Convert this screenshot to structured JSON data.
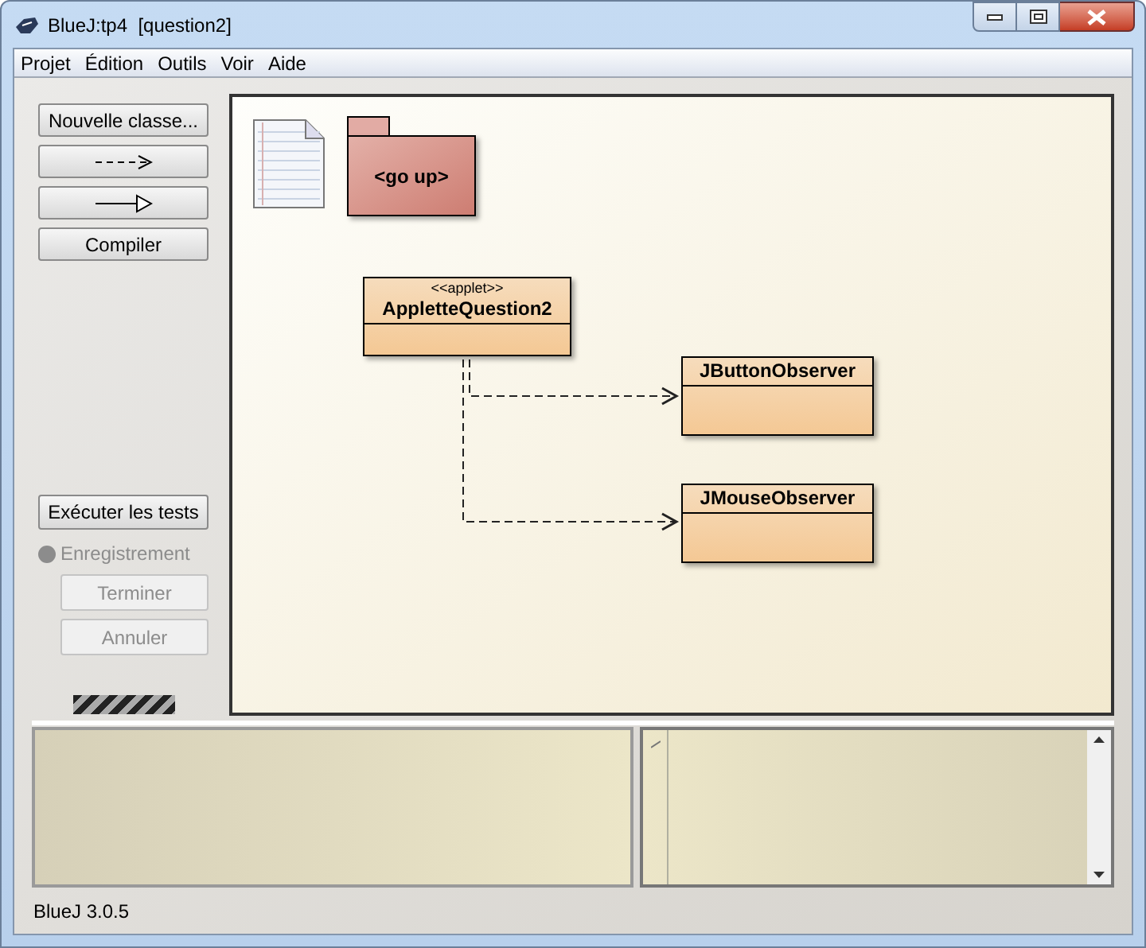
{
  "window": {
    "title": "BlueJ:tp4  [question2]"
  },
  "menu": [
    "Projet",
    "Édition",
    "Outils",
    "Voir",
    "Aide"
  ],
  "tools": [
    {
      "kind": "text",
      "label": "Nouvelle classe..."
    },
    {
      "kind": "dependency"
    },
    {
      "kind": "inheritance"
    },
    {
      "kind": "text",
      "label": "Compiler"
    }
  ],
  "tests": {
    "label": "Exécuter les tests"
  },
  "recording": {
    "label": "Enregistrement",
    "active": false
  },
  "recording_buttons": [
    {
      "label": "Terminer",
      "disabled": true
    },
    {
      "label": "Annuler",
      "disabled": true
    }
  ],
  "diagram": {
    "nodes": [
      {
        "kind": "readme"
      },
      {
        "kind": "package",
        "label": "<go up>"
      },
      {
        "kind": "class",
        "stereotype": "<<applet>>",
        "label": "AppletteQuestion2"
      },
      {
        "kind": "class",
        "label": "JButtonObserver"
      },
      {
        "kind": "class",
        "label": "JMouseObserver"
      }
    ],
    "connections": [
      {
        "kind": "dependency"
      },
      {
        "kind": "dependency"
      }
    ]
  },
  "status_bar": "BlueJ 3.0.5"
}
